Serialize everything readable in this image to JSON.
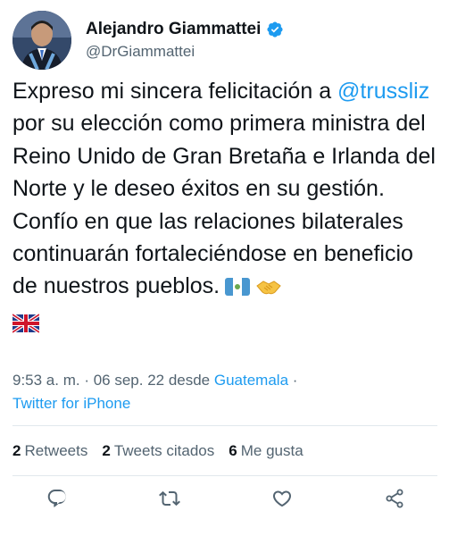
{
  "author": {
    "display_name": "Alejandro Giammattei",
    "handle": "@DrGiammattei",
    "verified_icon": "verified-badge-icon"
  },
  "tweet": {
    "text_before": "Expreso mi sincera felicitación a ",
    "mention": "@trussliz",
    "text_after": " por su elección como primera ministra del Reino Unido de Gran Bretaña e Irlanda del Norte y le deseo éxitos en su gestión. Confío en que las relaciones bilaterales continuarán fortaleciéndose en beneficio de nuestros pueblos.",
    "emojis": [
      "guatemala-flag-emoji",
      "handshake-emoji",
      "uk-flag-emoji"
    ]
  },
  "meta": {
    "time_date": "9:53 a. m. · 06 sep. 22 desde ",
    "location": "Guatemala",
    "separator": " ·",
    "source": "Twitter for iPhone"
  },
  "stats": [
    {
      "count": "2",
      "label": "Retweets"
    },
    {
      "count": "2",
      "label": "Tweets citados"
    },
    {
      "count": "6",
      "label": "Me gusta"
    }
  ],
  "actions": [
    "reply-icon",
    "retweet-icon",
    "like-icon",
    "share-icon"
  ],
  "colors": {
    "accent": "#1d9bf0",
    "text": "#0f1419",
    "secondary": "#536471",
    "divider": "#e1e8ed"
  }
}
